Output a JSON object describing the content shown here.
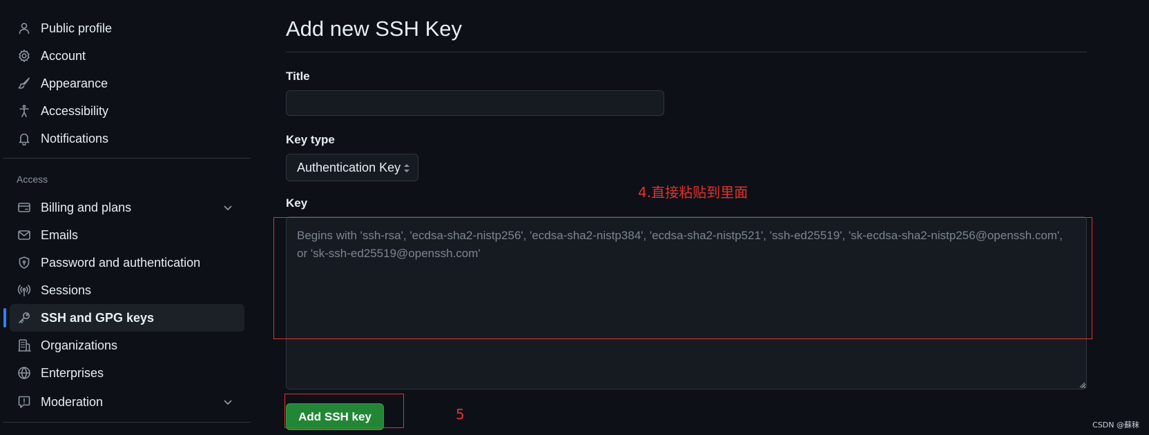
{
  "sidebar": {
    "items_top": [
      {
        "label": "Public profile",
        "icon": "person-icon"
      },
      {
        "label": "Account",
        "icon": "gear-icon"
      },
      {
        "label": "Appearance",
        "icon": "paintbrush-icon"
      },
      {
        "label": "Accessibility",
        "icon": "accessibility-icon"
      },
      {
        "label": "Notifications",
        "icon": "bell-icon"
      }
    ],
    "access_heading": "Access",
    "items_access": [
      {
        "label": "Billing and plans",
        "icon": "credit-card-icon",
        "expandable": true
      },
      {
        "label": "Emails",
        "icon": "mail-icon"
      },
      {
        "label": "Password and authentication",
        "icon": "shield-lock-icon"
      },
      {
        "label": "Sessions",
        "icon": "broadcast-icon"
      },
      {
        "label": "SSH and GPG keys",
        "icon": "key-icon",
        "active": true
      },
      {
        "label": "Organizations",
        "icon": "organization-icon"
      },
      {
        "label": "Enterprises",
        "icon": "globe-icon"
      },
      {
        "label": "Moderation",
        "icon": "report-icon",
        "expandable": true
      }
    ]
  },
  "main": {
    "title": "Add new SSH Key",
    "title_field": {
      "label": "Title",
      "value": "",
      "placeholder": ""
    },
    "key_type": {
      "label": "Key type",
      "selected": "Authentication Key"
    },
    "key_field": {
      "label": "Key",
      "value": "",
      "placeholder": "Begins with 'ssh-rsa', 'ecdsa-sha2-nistp256', 'ecdsa-sha2-nistp384', 'ecdsa-sha2-nistp521', 'ssh-ed25519', 'sk-ecdsa-sha2-nistp256@openssh.com', or 'sk-ssh-ed25519@openssh.com'"
    },
    "submit_label": "Add SSH key"
  },
  "annotations": {
    "step4": "4.直接粘贴到里面",
    "step5": "5"
  },
  "watermark": "CSDN @蘇秣",
  "colors": {
    "background": "#0d1117",
    "accent_blue": "#2f81f7",
    "primary_green": "#238636",
    "annotation_red": "#e5312e"
  }
}
